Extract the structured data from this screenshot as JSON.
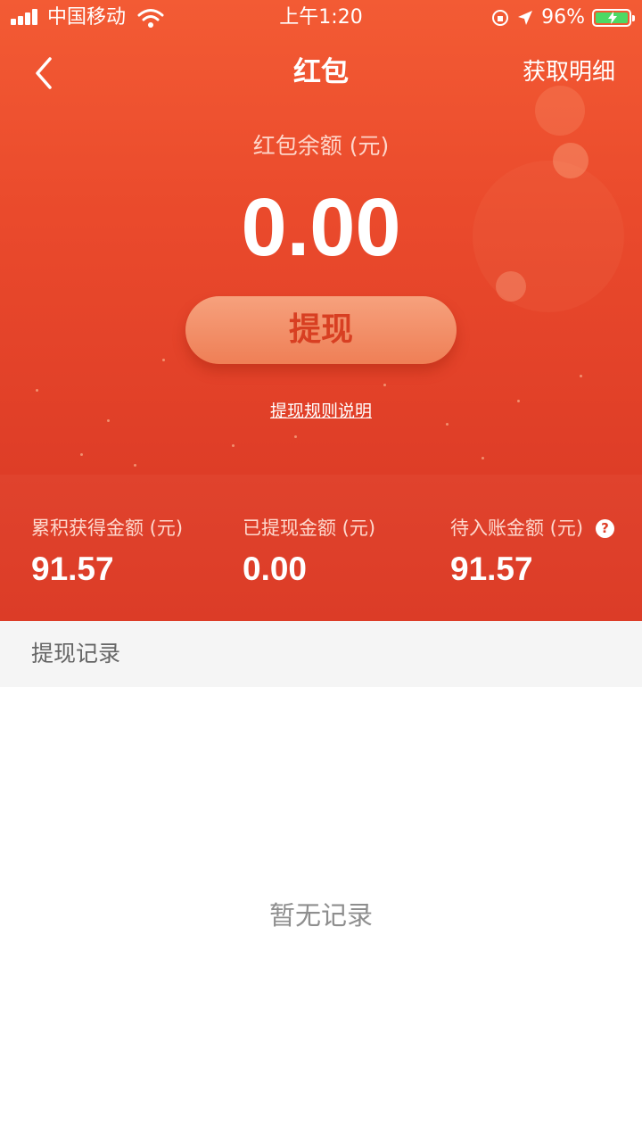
{
  "status_bar": {
    "carrier": "中国移动",
    "time": "上午1:20",
    "battery_percent": "96%",
    "battery_color": "#4cd964"
  },
  "nav": {
    "back_icon": "chevron-left-icon",
    "title": "红包",
    "action": "获取明细"
  },
  "balance": {
    "label": "红包余额 (元)",
    "value": "0.00"
  },
  "withdraw_button": "提现",
  "rules_link": "提现规则说明",
  "stats": [
    {
      "label": "累积获得金额 (元)",
      "value": "91.57"
    },
    {
      "label": "已提现金额 (元)",
      "value": "0.00"
    },
    {
      "label": "待入账金额 (元)",
      "value": "91.57"
    }
  ],
  "help_icon": {
    "name": "help-icon",
    "glyph": "?"
  },
  "records": {
    "title": "提现记录",
    "empty": "暂无记录"
  },
  "colors": {
    "primary": "#ea4a2c",
    "button_text": "#d83f22",
    "section_bg": "#f5f5f5"
  }
}
